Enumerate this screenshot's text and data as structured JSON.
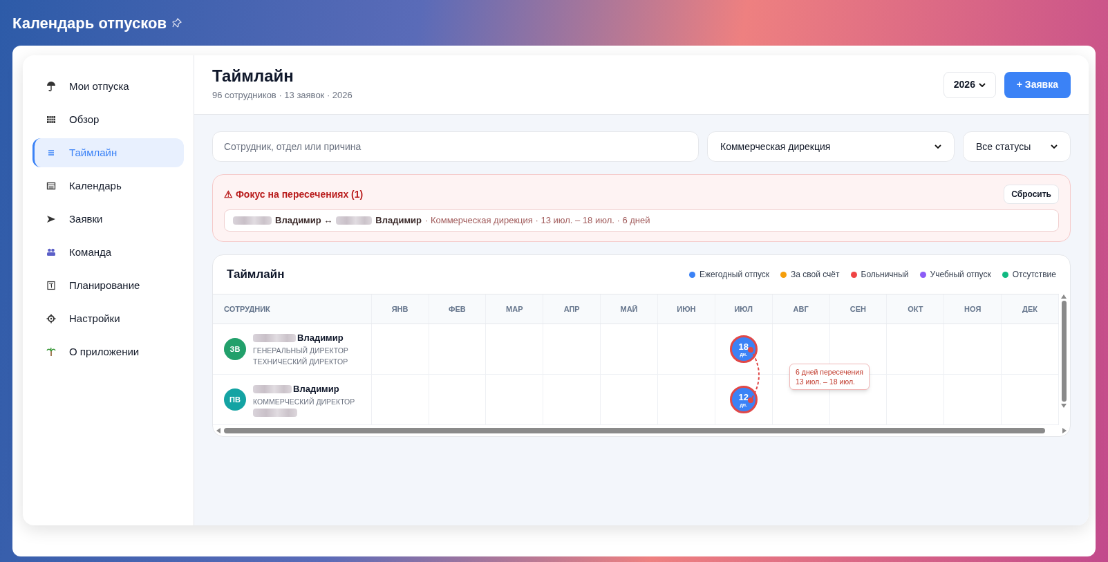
{
  "app_title": "Календарь отпусков",
  "nav": [
    {
      "label": "Мои отпуска",
      "selected": false
    },
    {
      "label": "Обзор",
      "selected": false
    },
    {
      "label": "Таймлайн",
      "selected": true
    },
    {
      "label": "Календарь",
      "selected": false
    },
    {
      "label": "Заявки",
      "selected": false
    },
    {
      "label": "Команда",
      "selected": false
    },
    {
      "label": "Планирование",
      "selected": false
    },
    {
      "label": "Настройки",
      "selected": false
    },
    {
      "label": "О приложении",
      "selected": false
    }
  ],
  "header": {
    "title": "Таймлайн",
    "subtitle": "96 сотрудников · 13 заявок · 2026",
    "year": "2026",
    "new_button": "+ Заявка"
  },
  "filters": {
    "search_placeholder": "Сотрудник, отдел или причина",
    "department": "Коммерческая дирекция",
    "status": "Все статусы"
  },
  "alert": {
    "title": "⚠ Фокус на пересечениях (1)",
    "reset_button": "Сбросить",
    "items": [
      {
        "person_a": "Владимир",
        "arrow": "↔",
        "person_b": "Владимир",
        "details": "· Коммерческая дирекция · 13 июл. – 18 июл. · 6 дней"
      }
    ]
  },
  "timeline": {
    "title": "Таймлайн",
    "legend": [
      {
        "label": "Ежегодный отпуск",
        "color": "#3b82f6"
      },
      {
        "label": "За свой счёт",
        "color": "#f59e0b"
      },
      {
        "label": "Больничный",
        "color": "#ef4444"
      },
      {
        "label": "Учебный отпуск",
        "color": "#8b5cf6"
      },
      {
        "label": "Отсутствие",
        "color": "#10b981"
      }
    ],
    "columns": [
      "СОТРУДНИК",
      "ЯНВ",
      "ФЕВ",
      "МАР",
      "АПР",
      "МАЙ",
      "ИЮН",
      "ИЮЛ",
      "АВГ",
      "СЕН",
      "ОКТ",
      "НОЯ",
      "ДЕК"
    ],
    "rows": [
      {
        "initials": "ЗВ",
        "color": "#22a06b",
        "name": "Владимир",
        "lines": [
          "ГЕНЕРАЛЬНЫЙ ДИРЕКТОР",
          "ТЕХНИЧЕСКИЙ ДИРЕКТОР"
        ],
        "redacted_line": false,
        "cells": [
          null,
          null,
          null,
          null,
          null,
          null,
          {
            "days": "18",
            "unit": "дн.",
            "color": "#3b82f6",
            "overlap": true
          },
          null,
          null,
          null,
          null,
          null
        ]
      },
      {
        "initials": "ПВ",
        "color": "#14a3a3",
        "name": "Владимир",
        "lines": [
          "КОММЕРЧЕСКИЙ ДИРЕКТОР"
        ],
        "redacted_line": true,
        "cells": [
          null,
          null,
          null,
          null,
          null,
          null,
          {
            "days": "12",
            "unit": "дн.",
            "color": "#3b82f6",
            "overlap": true
          },
          null,
          null,
          null,
          null,
          null
        ]
      }
    ],
    "overlap_tooltip": [
      "6 дней пересечения",
      "13 июл. – 18 июл."
    ]
  }
}
